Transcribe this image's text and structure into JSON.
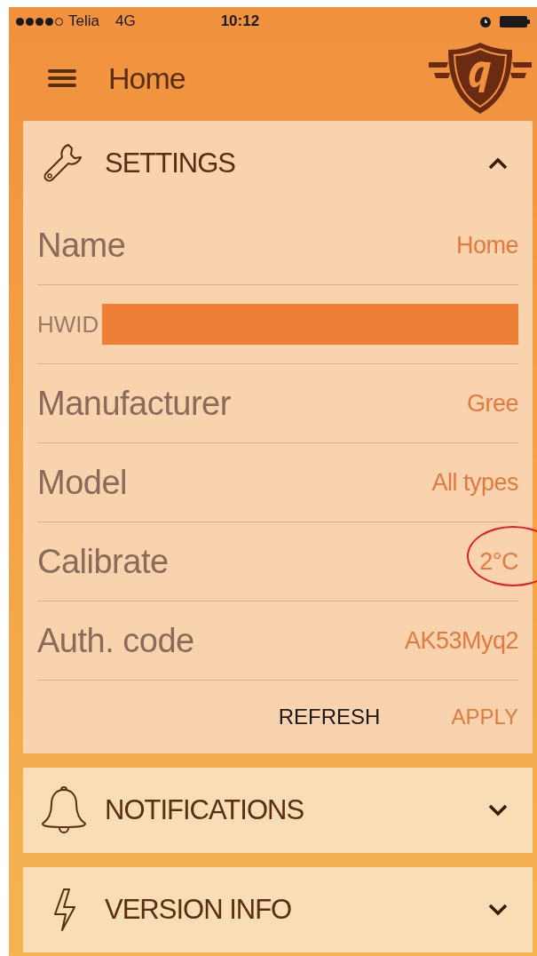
{
  "status_bar": {
    "carrier": "Telia",
    "network": "4G",
    "time": "10:12"
  },
  "header": {
    "title": "Home"
  },
  "sections": [
    {
      "kind": "settings",
      "title": "SETTINGS",
      "expanded": true,
      "fields": [
        {
          "label": "Name",
          "value": "Home",
          "redacted": false,
          "circled": false
        },
        {
          "label": "HWID",
          "redacted": true
        },
        {
          "label": "Manufacturer",
          "value": "Gree",
          "redacted": false,
          "circled": false
        },
        {
          "label": "Model",
          "value": "All types",
          "redacted": false,
          "circled": false
        },
        {
          "label": "Calibrate",
          "value": "2°C",
          "redacted": false,
          "circled": true
        },
        {
          "label": "Auth. code",
          "value": "AK53Myq2",
          "redacted": false,
          "circled": false
        }
      ],
      "actions": [
        {
          "label": "REFRESH",
          "primary": false
        },
        {
          "label": "APPLY",
          "primary": true
        }
      ]
    },
    {
      "kind": "notifications",
      "title": "NOTIFICATIONS",
      "expanded": false
    },
    {
      "kind": "version",
      "title": "VERSION INFO",
      "expanded": false
    }
  ]
}
